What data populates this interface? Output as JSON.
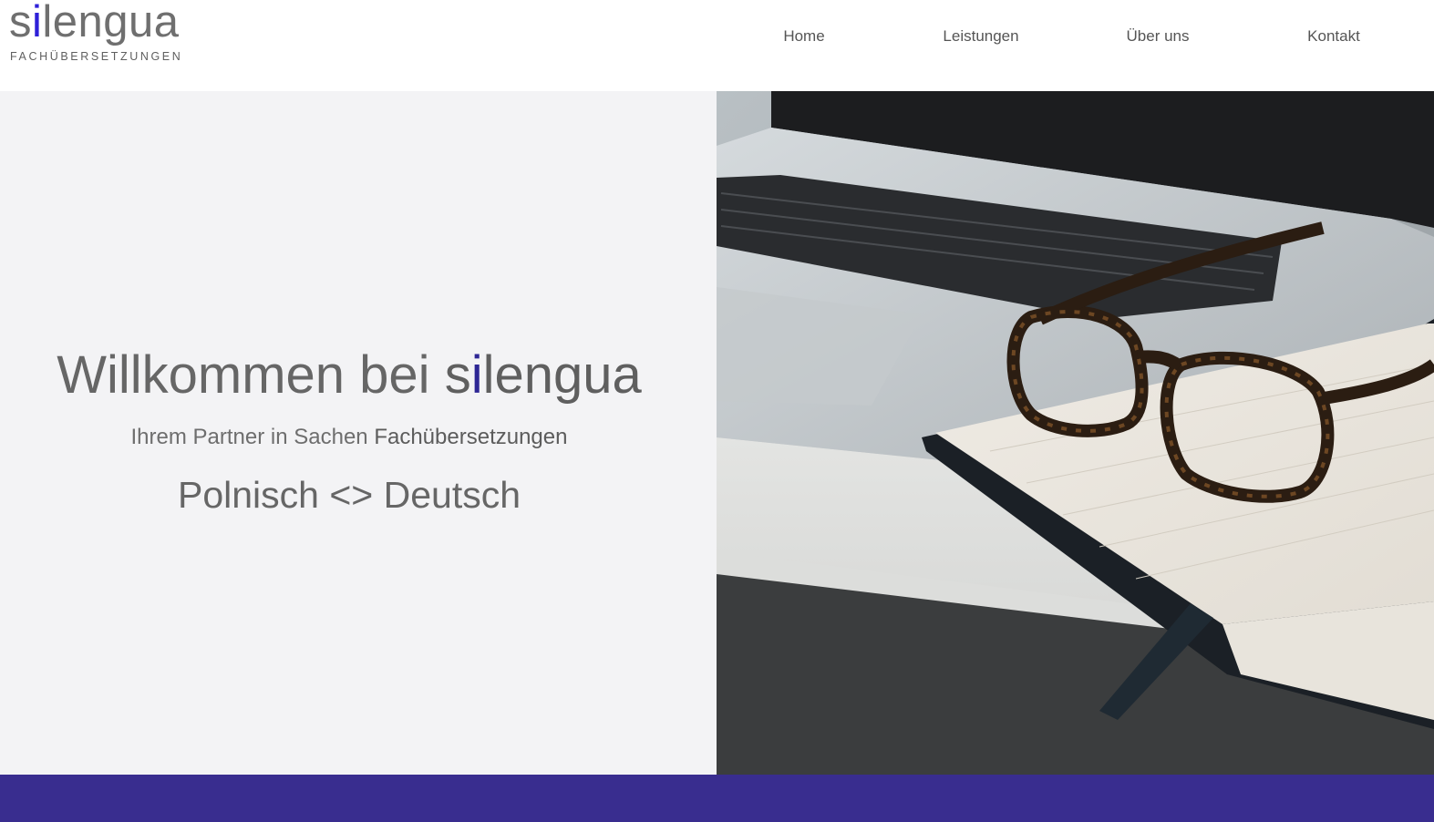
{
  "brand": {
    "logo_prefix": "s",
    "logo_accent": "i",
    "logo_suffix": "lengua",
    "tagline": "FACHÜBERSETZUNGEN",
    "accent_color": "#2e20d8"
  },
  "nav": {
    "items": [
      {
        "label": "Home"
      },
      {
        "label": "Leistungen"
      },
      {
        "label": "Über uns"
      },
      {
        "label": "Kontakt"
      }
    ]
  },
  "hero": {
    "title_prefix": "Willkommen bei ",
    "brand_prefix": "s",
    "brand_accent": "i",
    "brand_suffix": "lengua",
    "subtitle_prefix": "Ihrem Partner in Sachen ",
    "subtitle_strong": "Fachübersetzungen",
    "language_pair": "Polnisch <> Deutsch",
    "image_icon": "laptop-glasses-notebook-photo"
  },
  "colors": {
    "hero_background": "#f3f3f5",
    "footer_band": "#392d8f",
    "text": "#666666"
  }
}
